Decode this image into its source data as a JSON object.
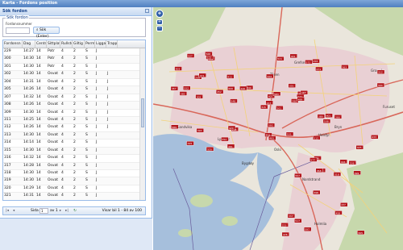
{
  "window": {
    "title": "Karta - Fordons position"
  },
  "search_panel": {
    "header": "Sök fordon",
    "legend": "Sök fordon",
    "sublabel": "Fordonsnummer",
    "input_value": "",
    "button_label": "Sök (Enter)"
  },
  "grid": {
    "columns": [
      "Fordonsn #1",
      "Dag",
      "Central",
      "Sittplats",
      "Rullstol",
      "Giltig",
      "Perm",
      "Liggar",
      "Trapp"
    ],
    "rows": [
      [
        "229",
        "14:27",
        "14",
        "Potr",
        "4",
        "2",
        "S",
        "J",
        ""
      ],
      [
        "300",
        "14:30",
        "14",
        "Potr",
        "4",
        "2",
        "S",
        "J",
        ""
      ],
      [
        "301",
        "14:30",
        "14",
        "Potr",
        "4",
        "2",
        "S",
        "J",
        ""
      ],
      [
        "302",
        "14:30",
        "14",
        "Osvat",
        "4",
        "2",
        "S",
        "J",
        "J"
      ],
      [
        "304",
        "14:31",
        "14",
        "Osvat",
        "4",
        "2",
        "S",
        "J",
        "J"
      ],
      [
        "305",
        "14:26",
        "14",
        "Osvat",
        "4",
        "2",
        "S",
        "J",
        "J"
      ],
      [
        "307",
        "14:32",
        "14",
        "Osvat",
        "4",
        "2",
        "S",
        "J",
        "J"
      ],
      [
        "308",
        "14:26",
        "14",
        "Osvat",
        "4",
        "2",
        "S",
        "J",
        "J"
      ],
      [
        "309",
        "14:30",
        "14",
        "Osvat",
        "4",
        "2",
        "S",
        "J",
        "J"
      ],
      [
        "311",
        "14:25",
        "14",
        "Osvat",
        "4",
        "2",
        "S",
        "J",
        "J"
      ],
      [
        "312",
        "14:26",
        "14",
        "Osvat",
        "4",
        "2",
        "S",
        "J",
        "J"
      ],
      [
        "313",
        "14:30",
        "14",
        "Osvat",
        "4",
        "2",
        "S",
        "J",
        ""
      ],
      [
        "314",
        "14:14",
        "14",
        "Osvat",
        "4",
        "2",
        "S",
        "J",
        ""
      ],
      [
        "315",
        "14:30",
        "14",
        "Osvat",
        "4",
        "2",
        "S",
        "J",
        ""
      ],
      [
        "316",
        "14:32",
        "14",
        "Osvat",
        "4",
        "2",
        "S",
        "J",
        ""
      ],
      [
        "317",
        "14:28",
        "14",
        "Osvat",
        "4",
        "2",
        "S",
        "J",
        ""
      ],
      [
        "318",
        "14:30",
        "14",
        "Osvat",
        "4",
        "2",
        "S",
        "J",
        ""
      ],
      [
        "319",
        "14:30",
        "14",
        "Osvat",
        "4",
        "2",
        "S",
        "J",
        ""
      ],
      [
        "320",
        "14:29",
        "14",
        "Osvat",
        "4",
        "2",
        "S",
        "J",
        ""
      ],
      [
        "321",
        "14:31",
        "14",
        "Osvat",
        "4",
        "2",
        "S",
        "J",
        ""
      ]
    ]
  },
  "pager": {
    "first_icon": "first-page-icon",
    "prev_icon": "prev-page-icon",
    "next_icon": "next-page-icon",
    "last_icon": "last-page-icon",
    "refresh_icon": "refresh-icon",
    "page_label": "Sida",
    "page_value": "1",
    "of_label": "av 1",
    "info": "Visar bil 1 - 84 av 100"
  },
  "map": {
    "zoom_in_label": "+",
    "zoom_out_label": "−",
    "markers": [
      "201",
      "205",
      "217",
      "223",
      "236",
      "244",
      "258",
      "262",
      "271",
      "280",
      "301",
      "305",
      "309",
      "312",
      "315",
      "318",
      "320",
      "324",
      "331",
      "337",
      "340",
      "345",
      "352",
      "358",
      "363",
      "366",
      "371",
      "376",
      "382",
      "389",
      "394",
      "398",
      "402",
      "407",
      "411",
      "416",
      "420",
      "425",
      "433",
      "437",
      "441",
      "446",
      "452",
      "458",
      "461",
      "467",
      "472",
      "478",
      "483",
      "489",
      "494",
      "499",
      "503",
      "508",
      "512",
      "517",
      "523",
      "527",
      "531",
      "536",
      "541",
      "548",
      "552",
      "557",
      "563",
      "568",
      "572",
      "577",
      "583",
      "589",
      "592",
      "597",
      "601",
      "606"
    ],
    "place_labels": [
      "Oslo",
      "Sandvika",
      "Lysaker",
      "Grefsen",
      "Grorud",
      "Furuset",
      "Nordstrand",
      "Holmlia",
      "Bygdøy",
      "Tåsen",
      "Bryn",
      "Helsfyr"
    ],
    "colors": {
      "land": "#eae6dc",
      "urban": "#e9cbd2",
      "water": "#a6bfdc",
      "forest": "#c7d8ac",
      "road_major": "#d9675a",
      "road_minor": "#f3d27a",
      "marker": "#b3151b"
    }
  }
}
